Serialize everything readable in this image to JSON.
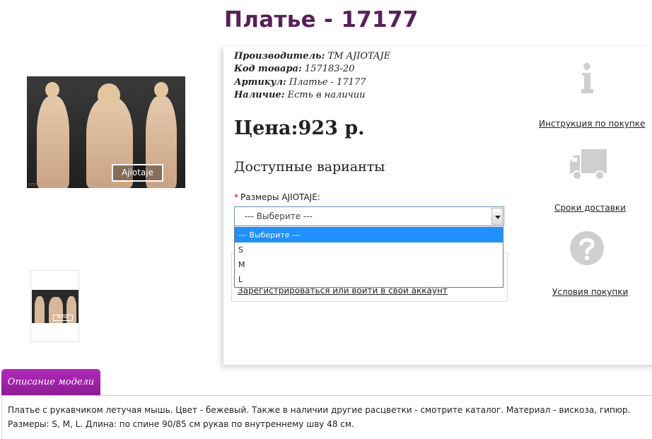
{
  "product": {
    "title": "Платье - 17177",
    "meta": {
      "manufacturer_label": "Производитель:",
      "manufacturer_value": "ТМ AJIOTAJE",
      "code_label": "Код товара:",
      "code_value": "157183-20",
      "article_label": "Артикул:",
      "article_value": "Платье - 17177",
      "availability_label": "Наличие:",
      "availability_value": "Есть в наличии"
    },
    "price": "Цена:923 р.",
    "variants_heading": "Доступные варианты",
    "photo_logo": "Ajiotaje",
    "photo_code": "17177",
    "thumb_logo": "Ajiotaje"
  },
  "size_select": {
    "required_mark": "*",
    "label": "Размеры AJIOTAJE:",
    "selected": "--- Выберите ---",
    "options": [
      "--- Выберите ---",
      "S",
      "M",
      "L"
    ]
  },
  "login": {
    "link": "Зарегистрироваться или войти в свой аккаунт"
  },
  "sidebar": {
    "instruction": "Инструкция по покупке",
    "delivery": "Сроки доставки",
    "terms": "Условия покупки"
  },
  "description": {
    "tab": "Описание модели",
    "text": "Платье с рукавчиком летучая мышь. Цвет - бежевый. Также в наличии другие расцветки - смотрите каталог. Материал - вискоза, гипюр. Размеры: S, M, L. Длина: по спине 90/85 см рукав по внутреннему шву 48 см."
  },
  "colors": {
    "title": "#5a1f58",
    "tab": "#9e22a7",
    "dropdown_highlight": "#1e90ff",
    "icon_gray": "#cfcfcf"
  }
}
